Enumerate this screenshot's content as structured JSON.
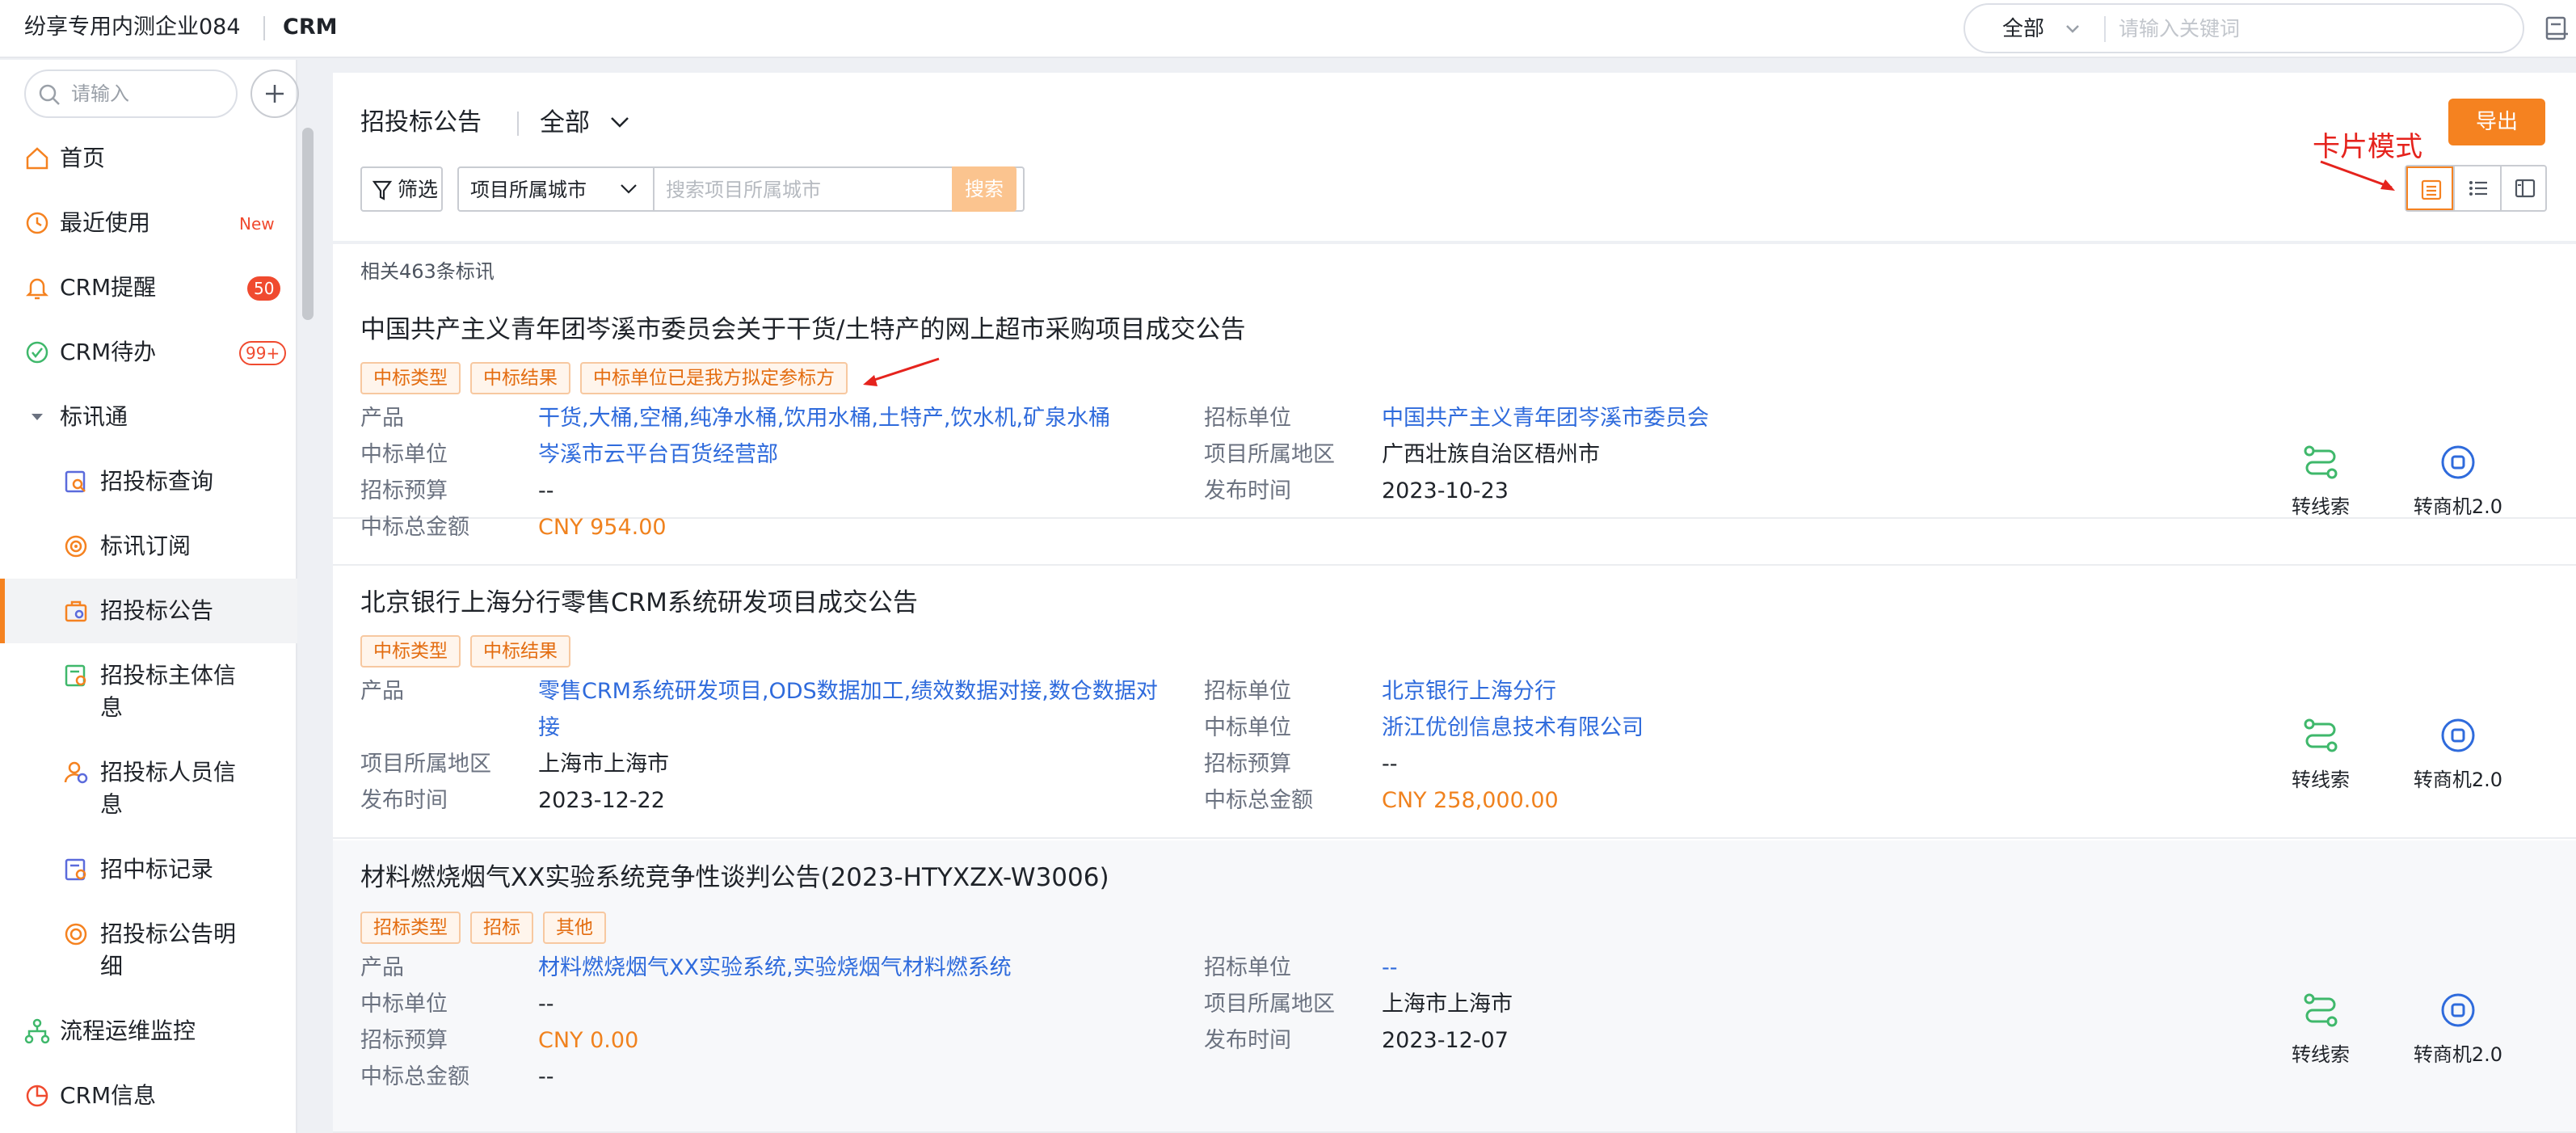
{
  "topbar": {
    "company": "纷享专用内测企业084",
    "app": "CRM",
    "search_scope": "全部",
    "search_placeholder": "请输入关键词"
  },
  "sidebar": {
    "search_placeholder": "请输入",
    "items": [
      {
        "label": "首页",
        "icon": "home-icon"
      },
      {
        "label": "最近使用",
        "icon": "clock-icon",
        "badge": "New"
      },
      {
        "label": "CRM提醒",
        "icon": "bell-icon",
        "badge": "50"
      },
      {
        "label": "CRM待办",
        "icon": "check-circle-icon",
        "badge": "99+"
      },
      {
        "label": "标讯通",
        "icon": "caret-down-icon"
      },
      {
        "label": "招投标查询",
        "icon": "search-doc-icon"
      },
      {
        "label": "标讯订阅",
        "icon": "subscribe-icon"
      },
      {
        "label": "招投标公告",
        "icon": "announce-icon",
        "active": true
      },
      {
        "label": "招投标主体信息",
        "icon": "entity-icon"
      },
      {
        "label": "招投标人员信息",
        "icon": "person-icon"
      },
      {
        "label": "招中标记录",
        "icon": "record-icon"
      },
      {
        "label": "招投标公告明细",
        "icon": "detail-icon"
      },
      {
        "label": "流程运维监控",
        "icon": "flow-icon"
      },
      {
        "label": "CRM信息",
        "icon": "info-icon"
      }
    ]
  },
  "header": {
    "title": "招投标公告",
    "scope": "全部",
    "filter_label": "筛选",
    "city_select": "项目所属城市",
    "city_placeholder": "搜索项目所属城市",
    "search_button": "搜索",
    "export_button": "导出",
    "annotation": "卡片模式"
  },
  "results": {
    "count_text": "相关463条标讯",
    "action_lead": "转线索",
    "action_opportunity": "转商机2.0",
    "cards": [
      {
        "title": "中国共产主义青年团岑溪市委员会关于干货/土特产的网上超市采购项目成交公告",
        "tags": [
          "中标类型",
          "中标结果",
          "中标单位已是我方拟定参标方"
        ],
        "left": [
          {
            "label": "产品",
            "value": "干货,大桶,空桶,纯净水桶,饮用水桶,土特产,饮水机,矿泉水桶",
            "style": "link"
          },
          {
            "label": "中标单位",
            "value": "岑溪市云平台百货经营部",
            "style": "link"
          },
          {
            "label": "招标预算",
            "value": "--",
            "style": "plain"
          },
          {
            "label": "中标总金额",
            "value": "CNY 954.00",
            "style": "money"
          }
        ],
        "right": [
          {
            "label": "招标单位",
            "value": "中国共产主义青年团岑溪市委员会",
            "style": "link"
          },
          {
            "label": "项目所属地区",
            "value": "广西壮族自治区梧州市",
            "style": "plain"
          },
          {
            "label": "发布时间",
            "value": "2023-10-23",
            "style": "plain"
          }
        ]
      },
      {
        "title": "北京银行上海分行零售CRM系统研发项目成交公告",
        "tags": [
          "中标类型",
          "中标结果"
        ],
        "product_line1": "零售CRM系统研发项目,ODS数据加工,绩效数据对接,数仓数据对",
        "product_line2": "接",
        "left": [
          {
            "label": "产品",
            "style": "link"
          },
          {
            "label": "项目所属地区",
            "value": "上海市上海市",
            "style": "plain"
          },
          {
            "label": "发布时间",
            "value": "2023-12-22",
            "style": "plain"
          }
        ],
        "right": [
          {
            "label": "招标单位",
            "value": "北京银行上海分行",
            "style": "link"
          },
          {
            "label": "中标单位",
            "value": "浙江优创信息技术有限公司",
            "style": "link"
          },
          {
            "label": "招标预算",
            "value": "--",
            "style": "plain"
          },
          {
            "label": "中标总金额",
            "value": "CNY 258,000.00",
            "style": "money"
          }
        ]
      },
      {
        "title": "材料燃烧烟气XX实验系统竞争性谈判公告(2023-HTYXZX-W3006)",
        "tags": [
          "招标类型",
          "招标",
          "其他"
        ],
        "left": [
          {
            "label": "产品",
            "value": "材料燃烧烟气XX实验系统,实验烧烟气材料燃系统",
            "style": "link"
          },
          {
            "label": "中标单位",
            "value": "--",
            "style": "plain"
          },
          {
            "label": "招标预算",
            "value": "CNY 0.00",
            "style": "money"
          },
          {
            "label": "中标总金额",
            "value": "--",
            "style": "plain"
          }
        ],
        "right": [
          {
            "label": "招标单位",
            "value": "--",
            "style": "link"
          },
          {
            "label": "项目所属地区",
            "value": "上海市上海市",
            "style": "plain"
          },
          {
            "label": "发布时间",
            "value": "2023-12-07",
            "style": "plain"
          }
        ]
      }
    ]
  },
  "colors": {
    "accent": "#f58220",
    "link": "#2f6bdc",
    "money": "#f0821e",
    "badge": "#f04a2f",
    "annotation": "#e5231d",
    "action_green": "#3fb86b",
    "action_blue": "#2f6bdc"
  }
}
